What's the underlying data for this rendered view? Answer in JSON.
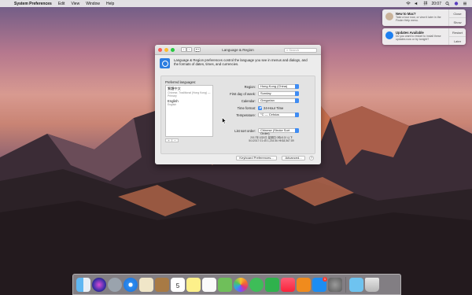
{
  "menubar": {
    "app_name": "System Preferences",
    "items": [
      "Edit",
      "View",
      "Window",
      "Help"
    ],
    "clock": "20:07",
    "input_source": "拼"
  },
  "notifications": [
    {
      "title": "New to Mac?",
      "text": "Take a tour now, or view it later in the Finder Help menu.",
      "action1": "Close",
      "action2": "Show",
      "icon_color": "#c9b39a"
    },
    {
      "title": "Updates Available",
      "text": "Do you want to restart to install these updates now or try tonight?",
      "action1": "Restart",
      "action2": "Later",
      "icon_color": "#1d7ff0"
    }
  ],
  "window": {
    "title": "Language & Region",
    "search_placeholder": "Search",
    "intro": "Language & Region preferences control the language you see in menus and dialogs, and the formats of dates, times, and currencies.",
    "preferred_label": "Preferred languages:",
    "languages": [
      {
        "name": "繁體中文",
        "sub": "Chinese, Traditional (Hong Kong) — Primary"
      },
      {
        "name": "English",
        "sub": "English"
      }
    ],
    "region_label": "Region:",
    "region_value": "Hong Kong (China)",
    "first_day_label": "First day of week:",
    "first_day_value": "Sunday",
    "calendar_label": "Calendar:",
    "calendar_value": "Gregorian",
    "time_format_label": "Time format:",
    "time_format_value": "24-Hour Time",
    "temperature_label": "Temperature:",
    "temperature_value": "°C — Celsius",
    "sort_label": "List sort order:",
    "sort_value": "Chinese (Stroke Sort Order)",
    "sample_line1": "2017年1月5日 星期四 0時41分 以下",
    "sample_line2": "5/1/2017 01:45    1,234.56    HK$4,567.89",
    "keyboard_button": "Keyboard Preferences...",
    "advanced_button": "Advanced...",
    "help_button": "?"
  },
  "dock": {
    "calendar_day": "5",
    "appstore_badge": "1"
  }
}
